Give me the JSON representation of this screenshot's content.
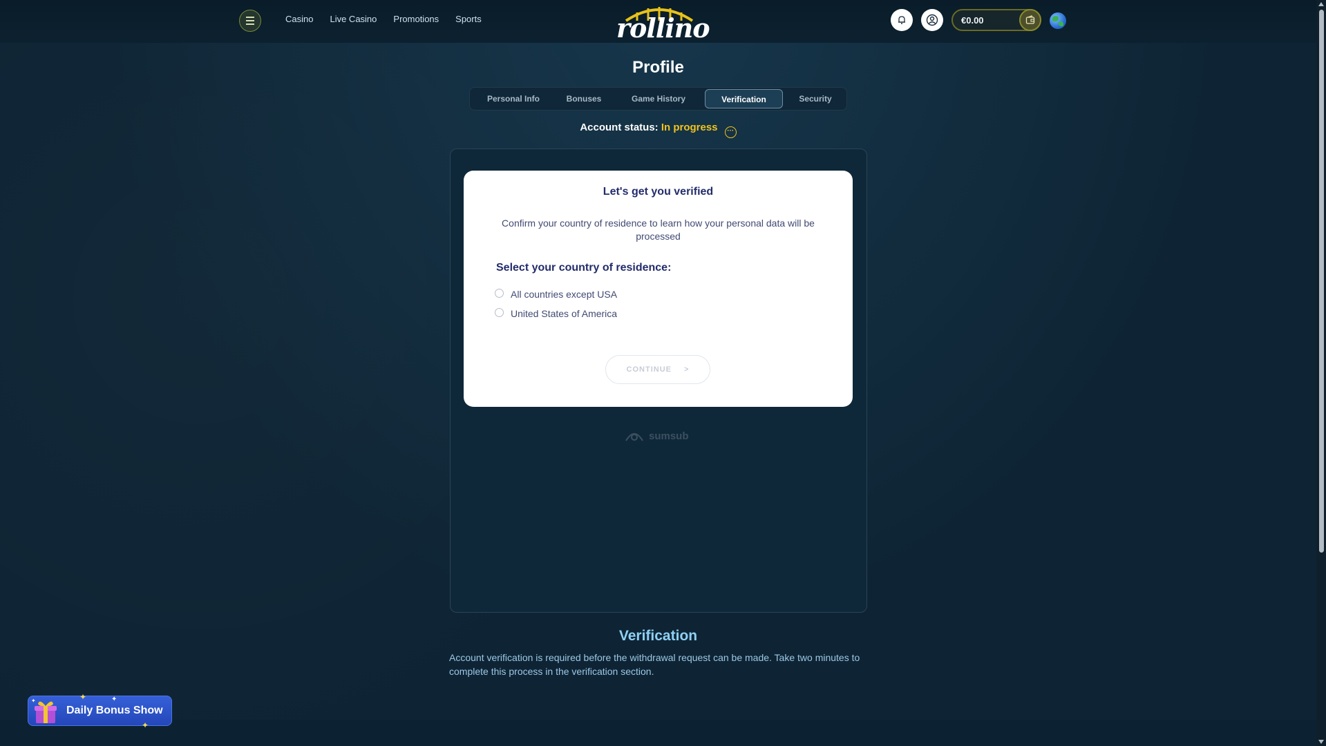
{
  "header": {
    "nav": [
      "Casino",
      "Live Casino",
      "Promotions",
      "Sports"
    ],
    "logo_text": "rollino",
    "balance": "€0.00",
    "icons": {
      "menu": "menu-icon",
      "bell": "bell-icon",
      "user": "user-icon",
      "wallet": "wallet-icon",
      "globe": "globe-icon"
    }
  },
  "profile": {
    "title": "Profile",
    "tabs": [
      "Personal Info",
      "Bonuses",
      "Game History",
      "Verification",
      "Security"
    ],
    "active_tab": "Verification",
    "status_label": "Account status:",
    "status_value": "In progress"
  },
  "verify_card": {
    "title": "Let's get you verified",
    "description": "Confirm your country of residence to learn how your personal data will be processed",
    "select_label": "Select your country of residence:",
    "options": [
      "All countries except USA",
      "United States of America"
    ],
    "continue_label": "CONTINUE",
    "continue_arrow": ">"
  },
  "provider": "sumsub",
  "verification_info": {
    "title": "Verification",
    "text": "Account verification is required before the withdrawal request can be made. Take two minutes to complete this process in the verification section."
  },
  "promo": {
    "label": "Daily Bonus Show"
  },
  "colors": {
    "background": "#0e2434",
    "accent_yellow": "#f0c31e",
    "card_title": "#232c6a",
    "verification_title": "#8fd0f5",
    "promo_blue": "#2f55cf"
  }
}
